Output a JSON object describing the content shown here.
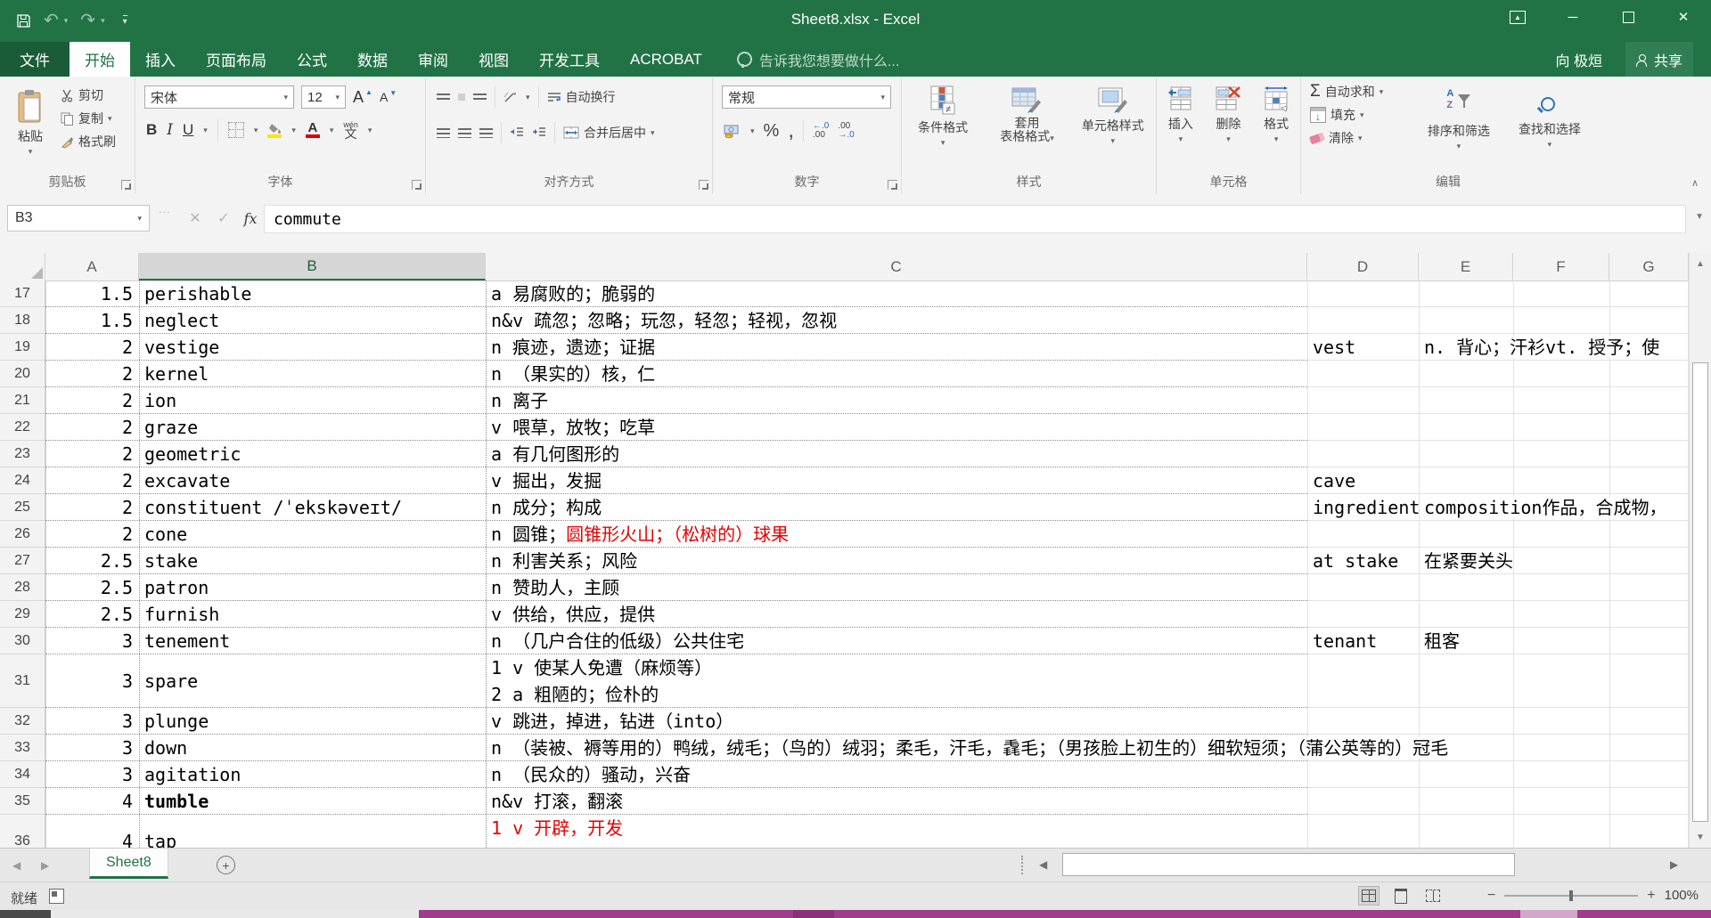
{
  "app": {
    "title": "Sheet8.xlsx - Excel"
  },
  "menu": {
    "file": "文件",
    "tabs": [
      "开始",
      "插入",
      "页面布局",
      "公式",
      "数据",
      "审阅",
      "视图",
      "开发工具",
      "ACROBAT"
    ],
    "active_tab": "开始",
    "tell_me": "告诉我您想要做什么...",
    "user": "向 极烜",
    "share": "共享"
  },
  "ribbon": {
    "paste": "粘贴",
    "cut": "剪切",
    "copy": "复制",
    "format_painter": "格式刷",
    "font_name": "宋体",
    "font_size": "12",
    "grow_font": "A",
    "shrink_font": "A",
    "bold": "B",
    "italic": "I",
    "underline": "U",
    "phonetic": "文",
    "phonetic_small": "wén",
    "wrap_text": "自动换行",
    "merge_center": "合并后居中",
    "number_format": "常规",
    "percent": "%",
    "comma": ",",
    "dec_inc_1": "←.0",
    "dec_inc_2": ".00",
    "dec_dec_1": ".00",
    "dec_dec_2": "→.0",
    "conditional_format": "条件格式",
    "format_table_line1": "套用",
    "format_table_line2": "表格格式",
    "cell_styles": "单元格样式",
    "insert": "插入",
    "delete": "删除",
    "format": "格式",
    "autosum": "自动求和",
    "fill": "填充",
    "clear": "清除",
    "sort_filter": "排序和筛选",
    "find_select": "查找和选择",
    "groups": {
      "clipboard": "剪贴板",
      "font": "字体",
      "alignment": "对齐方式",
      "number": "数字",
      "styles": "样式",
      "cells": "单元格",
      "editing": "编辑"
    }
  },
  "formula_bar": {
    "name_box": "B3",
    "fx": "fx",
    "value": "commute"
  },
  "grid": {
    "columns": [
      "A",
      "B",
      "C",
      "D",
      "E",
      "F",
      "G"
    ],
    "selected_column": "B",
    "rows": [
      {
        "n": "17",
        "a": "1.5",
        "b": "perishable",
        "c": "a 易腐败的；脆弱的"
      },
      {
        "n": "18",
        "a": "1.5",
        "b": "neglect",
        "c": "n&v 疏忽；忽略；玩忽，轻忽；轻视，忽视"
      },
      {
        "n": "19",
        "a": "2",
        "b": "vestige",
        "c": "n 痕迹，遗迹；证据",
        "d": "vest",
        "e": "n. 背心；汗衫vt. 授予；使",
        "e_overflow": true
      },
      {
        "n": "20",
        "a": "2",
        "b": "kernel",
        "c": "n （果实的）核，仁"
      },
      {
        "n": "21",
        "a": "2",
        "b": "ion",
        "c": "n 离子"
      },
      {
        "n": "22",
        "a": "2",
        "b": "graze",
        "c": "v 喂草，放牧；吃草"
      },
      {
        "n": "23",
        "a": "2",
        "b": "geometric",
        "c": "a 有几何图形的"
      },
      {
        "n": "24",
        "a": "2",
        "b": "excavate",
        "c": "v 掘出，发掘",
        "d": "cave"
      },
      {
        "n": "25",
        "a": "2",
        "b": "constituent /ˈekskəveɪt/",
        "c": "n 成分；构成",
        "d": "ingredient",
        "e": "composition作品，合成物，",
        "e_overflow": true
      },
      {
        "n": "26",
        "a": "2",
        "b": "cone",
        "c": "n 圆锥；",
        "c_red": "圆锥形火山；（松树的）球果"
      },
      {
        "n": "27",
        "a": "2.5",
        "b": "stake",
        "c": "n 利害关系；风险",
        "d": "at stake",
        "e": "在紧要关头"
      },
      {
        "n": "28",
        "a": "2.5",
        "b": "patron",
        "c": "n 赞助人，主顾"
      },
      {
        "n": "29",
        "a": "2.5",
        "b": "furnish",
        "c": "v 供给，供应，提供"
      },
      {
        "n": "30",
        "a": "3",
        "b": "tenement",
        "c": "n （几户合住的低级）公共住宅",
        "d": "tenant",
        "e": "租客"
      },
      {
        "n": "31",
        "a": "3",
        "b": "spare",
        "c": "1 v 使某人免遭（麻烦等）",
        "c2": "2 a 粗陋的；俭朴的",
        "tall": true
      },
      {
        "n": "32",
        "a": "3",
        "b": "plunge",
        "c": "v 跳进，掉进，钻进（into）"
      },
      {
        "n": "33",
        "a": "3",
        "b": "down",
        "c": "n （装被、褥等用的）鸭绒，绒毛；（鸟的）绒羽；柔毛，汗毛，毳毛；（男孩脸上初生的）细软短须；（蒲公英等的）冠毛",
        "c_overflow": true
      },
      {
        "n": "34",
        "a": "3",
        "b": "agitation",
        "c": "n （民众的）骚动，兴奋"
      },
      {
        "n": "35",
        "a": "4",
        "b": "tumble",
        "c": "n&v 打滚，翻滚",
        "b_bold": true
      },
      {
        "n": "36",
        "a": "4",
        "b": "tap",
        "c_red": "1 v 开辟，开发",
        "tall": true
      }
    ]
  },
  "sheet_bar": {
    "active_sheet": "Sheet8"
  },
  "status_bar": {
    "mode": "就绪",
    "zoom_level": "100%"
  },
  "glyphs": {
    "caret": "▾",
    "dropdown": "▼",
    "up": "▲",
    "down": "▼",
    "left": "◀",
    "right": "▶",
    "undo": "↶",
    "redo": "↷",
    "minimize": "─",
    "close": "✕",
    "check": "✓",
    "cross": "✕",
    "sigma": "Σ",
    "fill_down": "↓",
    "merge": "↔",
    "orient": "ab",
    "collapse": "∧",
    "neq": "≠",
    "zoom_minus": "−",
    "zoom_plus": "+",
    "add_sheet": "+",
    "ribbon_show": "▲"
  }
}
